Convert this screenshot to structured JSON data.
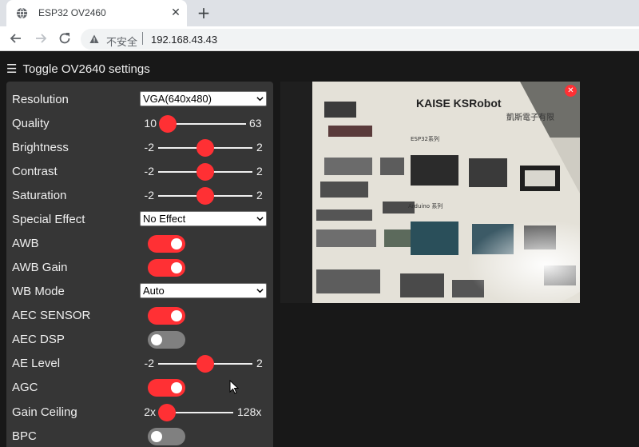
{
  "browser": {
    "tab_title": "ESP32 OV2460",
    "insecure_label": "不安全",
    "url": "192.168.43.43"
  },
  "page": {
    "toggle_label": "Toggle OV2640 settings"
  },
  "settings": {
    "resolution": {
      "label": "Resolution",
      "value": "VGA(640x480)"
    },
    "quality": {
      "label": "Quality",
      "min": "10",
      "max": "63",
      "level": 0
    },
    "brightness": {
      "label": "Brightness",
      "min": "-2",
      "max": "2",
      "level": 0.5
    },
    "contrast": {
      "label": "Contrast",
      "min": "-2",
      "max": "2",
      "level": 0.5
    },
    "saturation": {
      "label": "Saturation",
      "min": "-2",
      "max": "2",
      "level": 0.5
    },
    "special_effect": {
      "label": "Special Effect",
      "value": "No Effect"
    },
    "awb": {
      "label": "AWB",
      "on": true
    },
    "awb_gain": {
      "label": "AWB Gain",
      "on": true
    },
    "wb_mode": {
      "label": "WB Mode",
      "value": "Auto"
    },
    "aec_sensor": {
      "label": "AEC SENSOR",
      "on": true
    },
    "aec_dsp": {
      "label": "AEC DSP",
      "on": false
    },
    "ae_level": {
      "label": "AE Level",
      "min": "-2",
      "max": "2",
      "level": 0.5
    },
    "agc": {
      "label": "AGC",
      "on": true
    },
    "gain_ceiling": {
      "label": "Gain Ceiling",
      "min": "2x",
      "max": "128x",
      "level": 0
    },
    "bpc": {
      "label": "BPC",
      "on": false
    }
  },
  "stream": {
    "headline": "KAISE KSRobot",
    "brand_cn": "凱斯電子有限",
    "section_esp32": "ESP32系列",
    "section_arduino": "Arduino 系列"
  },
  "colors": {
    "accent": "#ff3034",
    "panel": "#363636",
    "background": "#181818",
    "switch_off": "#808080"
  },
  "icons": {
    "tab_favicon": "globe-icon",
    "back": "arrow-left-icon",
    "forward": "arrow-right-icon",
    "reload": "reload-icon",
    "security": "warning-triangle-icon",
    "menu": "hamburger-icon",
    "close_stream": "close-icon"
  }
}
